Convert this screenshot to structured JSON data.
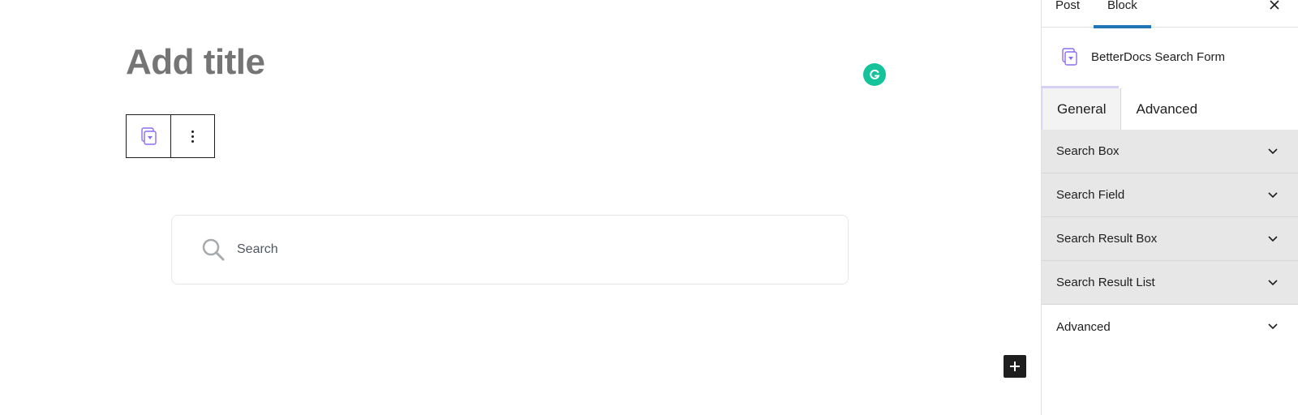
{
  "editor": {
    "title_placeholder": "Add title",
    "search_placeholder": "Search"
  },
  "sidebar": {
    "tabs": [
      {
        "label": "Post",
        "active": false
      },
      {
        "label": "Block",
        "active": true
      }
    ],
    "block_name": "BetterDocs Search Form",
    "panel_tabs": [
      {
        "label": "General",
        "active": true
      },
      {
        "label": "Advanced",
        "active": false
      }
    ],
    "sections": [
      {
        "label": "Search Box"
      },
      {
        "label": "Search Field"
      },
      {
        "label": "Search Result Box"
      },
      {
        "label": "Search Result List"
      },
      {
        "label": "Advanced"
      }
    ]
  },
  "colors": {
    "accent": "#1e77b4",
    "grammarly": "#15c39a",
    "block_icon": "#8b6cf0"
  }
}
